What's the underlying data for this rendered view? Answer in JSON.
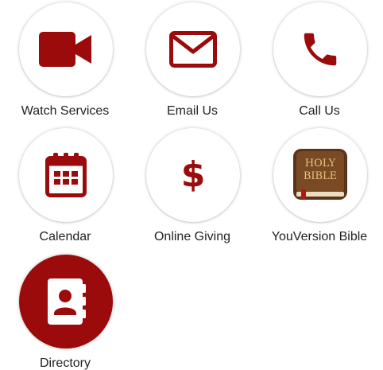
{
  "accent_color": "#9b0b0b",
  "tiles": [
    {
      "label": "Watch Services",
      "icon": "video-camera-icon"
    },
    {
      "label": "Email Us",
      "icon": "envelope-icon"
    },
    {
      "label": "Call Us",
      "icon": "phone-icon"
    },
    {
      "label": "Calendar",
      "icon": "calendar-icon"
    },
    {
      "label": "Online Giving",
      "icon": "dollar-icon",
      "symbol": "$"
    },
    {
      "label": "YouVersion Bible",
      "icon": "holy-bible-icon",
      "book_title_line1": "HOLY",
      "book_title_line2": "BIBLE"
    },
    {
      "label": "Directory",
      "icon": "contact-book-icon"
    }
  ]
}
